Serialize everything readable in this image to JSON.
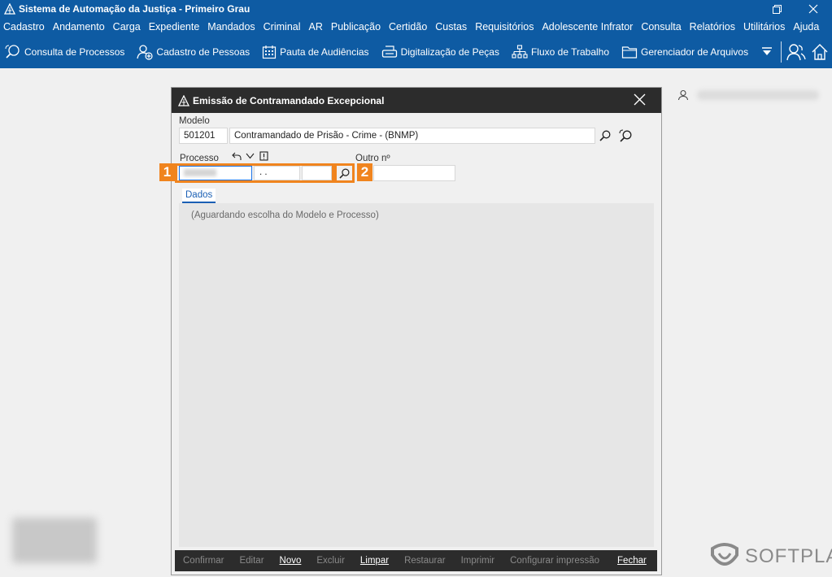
{
  "window": {
    "title": "Sistema de Automação da Justiça - Primeiro Grau"
  },
  "menu": [
    "Cadastro",
    "Andamento",
    "Carga",
    "Expediente",
    "Mandados",
    "Criminal",
    "AR",
    "Publicação",
    "Certidão",
    "Custas",
    "Requisitórios",
    "Adolescente Infrator",
    "Consulta",
    "Relatórios",
    "Utilitários",
    "Ajuda"
  ],
  "toolbar": [
    {
      "label": "Consulta de Processos",
      "icon": "search-process-icon"
    },
    {
      "label": "Cadastro de Pessoas",
      "icon": "add-person-icon"
    },
    {
      "label": "Pauta de Audiências",
      "icon": "calendar-icon"
    },
    {
      "label": "Digitalização de Peças",
      "icon": "scanner-icon"
    },
    {
      "label": "Fluxo de Trabalho",
      "icon": "workflow-icon"
    },
    {
      "label": "Gerenciador de Arquivos",
      "icon": "folder-icon"
    }
  ],
  "dialog": {
    "title": "Emissão de Contramandado Excepcional",
    "modelo_label": "Modelo",
    "modelo_code": "501201",
    "modelo_desc": "Contramandado de Prisão - Crime - (BNMP)",
    "processo_label": "Processo",
    "processo_part2": ". .",
    "outro_label": "Outro nº",
    "callout_1": "1",
    "callout_2": "2",
    "tab_label": "Dados",
    "waiting_text": "(Aguardando escolha do Modelo e Processo)",
    "buttons": [
      {
        "label": "Confirmar",
        "enabled": false
      },
      {
        "label": "Editar",
        "enabled": false
      },
      {
        "label": "Novo",
        "enabled": true
      },
      {
        "label": "Excluir",
        "enabled": false
      },
      {
        "label": "Limpar",
        "enabled": true
      },
      {
        "label": "Restaurar",
        "enabled": false
      },
      {
        "label": "Imprimir",
        "enabled": false
      },
      {
        "label": "Configurar impressão",
        "enabled": false
      },
      {
        "label": "Fechar",
        "enabled": true
      }
    ]
  },
  "brand": {
    "name": "SOFTPLAN"
  },
  "colors": {
    "accent_blue": "#0e5ba3",
    "callout_orange": "#f0841e",
    "dialog_dark": "#2c2c2c"
  }
}
